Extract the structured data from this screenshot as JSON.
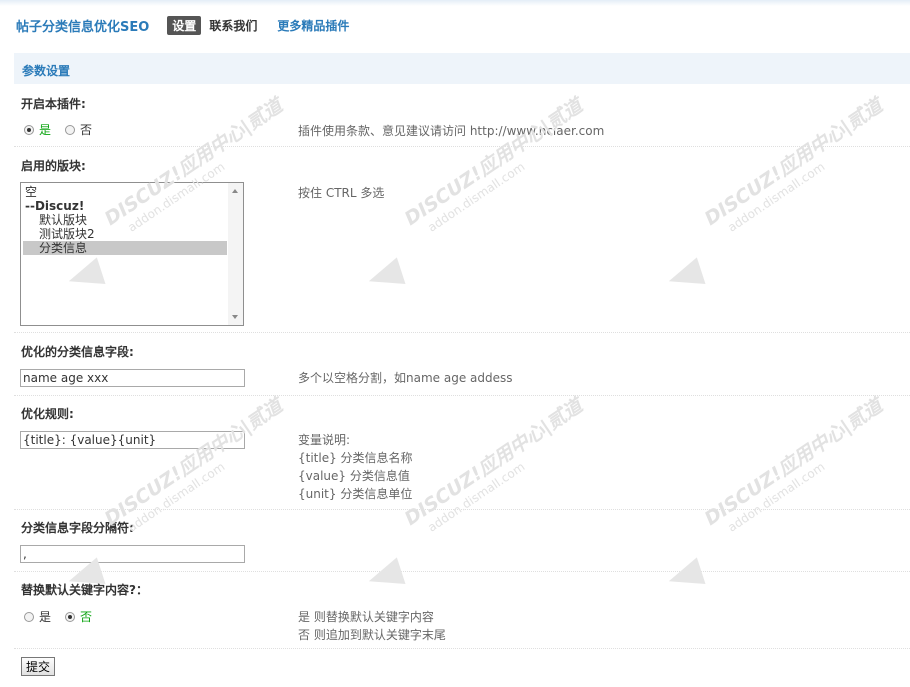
{
  "header": {
    "plugin_title": "帖子分类信息优化SEO",
    "tabs": [
      {
        "label": "设置",
        "active": true
      },
      {
        "label": "联系我们",
        "active": false
      },
      {
        "label": "更多精品插件",
        "active": false,
        "link": true
      }
    ]
  },
  "section": {
    "title": "参数设置"
  },
  "settings": {
    "enable": {
      "label": "开启本插件:",
      "options": [
        {
          "label": "是",
          "checked": true
        },
        {
          "label": "否",
          "checked": false
        }
      ],
      "hint": "插件使用条款、意见建议请访问 http://www.nciaer.com"
    },
    "forums": {
      "label": "启用的版块:",
      "items": [
        {
          "label": "空",
          "type": "option"
        },
        {
          "label": "--Discuz!",
          "type": "group"
        },
        {
          "label": "默认版块",
          "type": "child"
        },
        {
          "label": "测试版块2",
          "type": "child"
        },
        {
          "label": "分类信息",
          "type": "child",
          "selected": true
        }
      ],
      "hint": "按住 CTRL 多选"
    },
    "fields": {
      "label": "优化的分类信息字段:",
      "value": "name age xxx",
      "hint": "多个以空格分割，如name age addess"
    },
    "rule": {
      "label": "优化规则:",
      "value": "{title}: {value}{unit}",
      "hint_lines": [
        "变量说明:",
        "{title} 分类信息名称",
        "{value} 分类信息值",
        "{unit} 分类信息单位"
      ]
    },
    "separator": {
      "label": "分类信息字段分隔符:",
      "value": ","
    },
    "replace": {
      "label": "替换默认关键字内容?：",
      "options": [
        {
          "label": "是",
          "checked": false
        },
        {
          "label": "否",
          "checked": true
        }
      ],
      "hint_lines": [
        "是 则替换默认关键字内容",
        "否 则追加到默认关键字末尾"
      ]
    }
  },
  "submit_label": "提交",
  "watermark": {
    "main": "DISCUZ!应用中心|贰道",
    "sub": "addon.dismall.com"
  },
  "colors": {
    "accent": "#2b7bb9",
    "checked_option": "#09a30e",
    "section_bg": "#eef4fa"
  }
}
